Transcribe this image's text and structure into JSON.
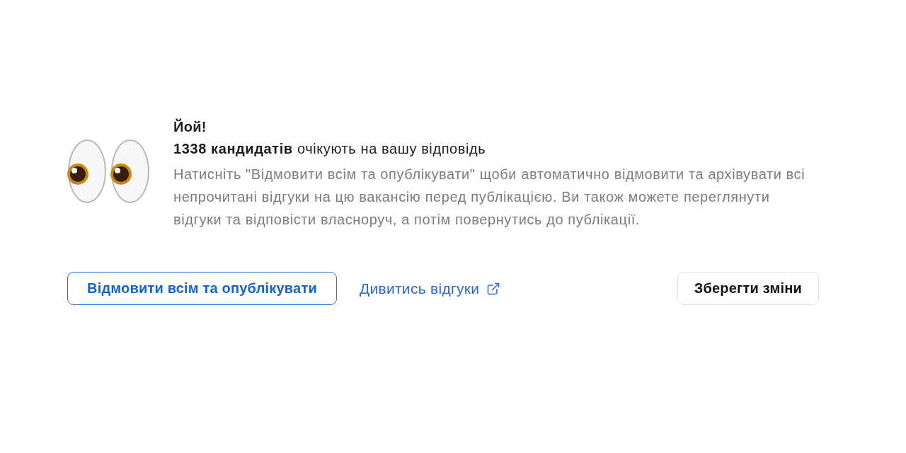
{
  "notice": {
    "title": "Йой!",
    "subtitle": "**1338 кандидатів** очікують на вашу відповідь",
    "description": "Натисніть \"Відмовити всім та опублікувати\" щоби автоматично відмовити та архівувати всі непрочитані відгуки на цю вакансію перед публікацією. Ви також можете переглянути відгуки та відповісти власноруч, а потім повернутись до публікації."
  },
  "actions": [
    {
      "kind": "outline",
      "label": "Відмовити всім та опублікувати"
    },
    {
      "kind": "link",
      "label": "Дивитись відгуки"
    },
    {
      "kind": "secondary",
      "label": "Зберегти зміни"
    }
  ]
}
